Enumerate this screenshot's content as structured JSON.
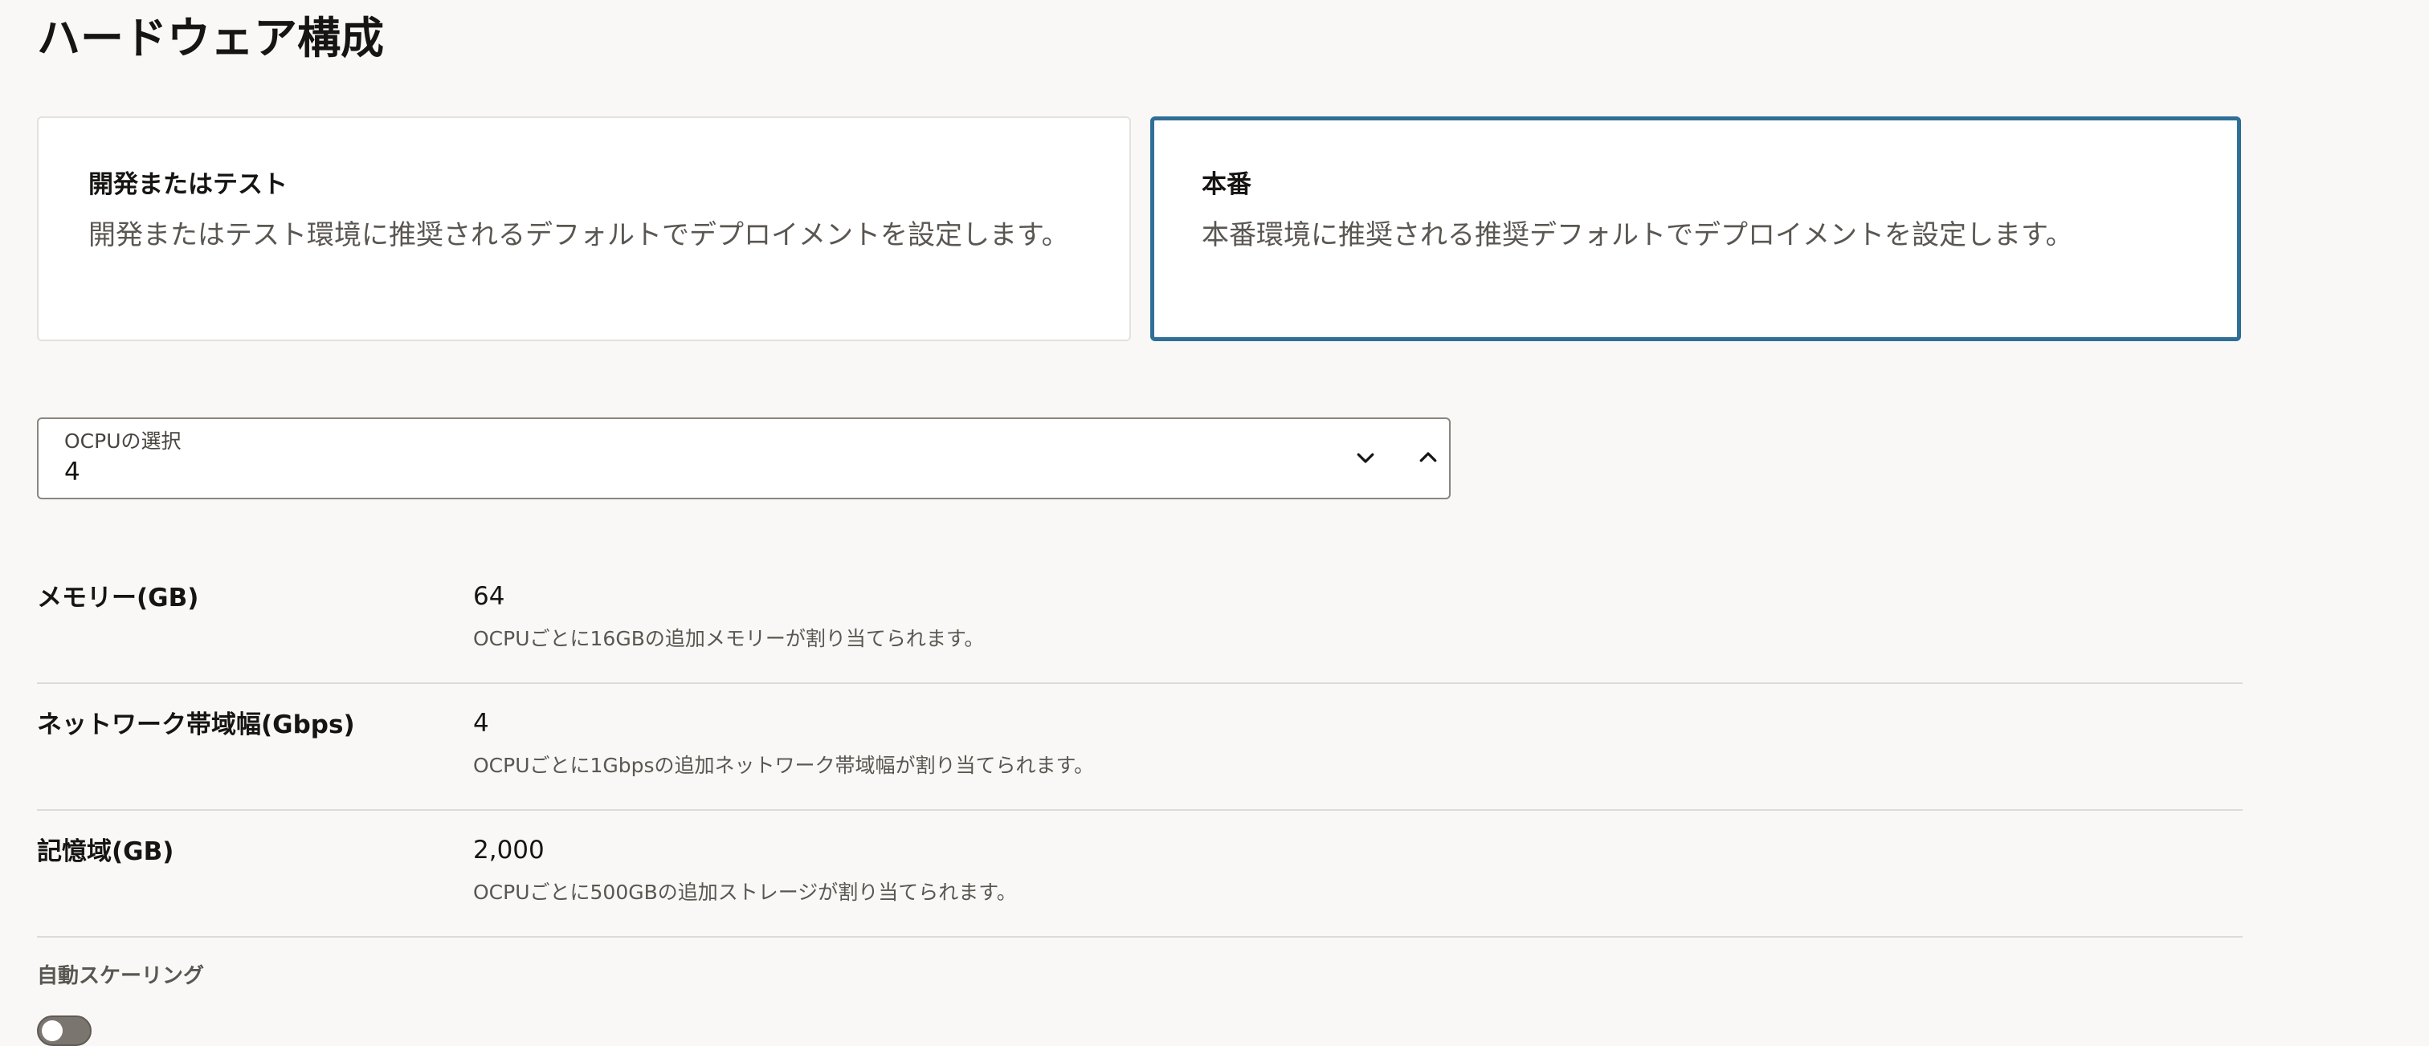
{
  "page": {
    "title": "ハードウェア構成"
  },
  "presets": [
    {
      "title": "開発またはテスト",
      "description": "開発またはテスト環境に推奨されるデフォルトでデプロイメントを設定します。",
      "selected": false
    },
    {
      "title": "本番",
      "description": "本番環境に推奨される推奨デフォルトでデプロイメントを設定します。",
      "selected": true
    }
  ],
  "ocpu": {
    "label": "OCPUの選択",
    "value": "4",
    "decrement_icon": "chevron-down-icon",
    "increment_icon": "chevron-up-icon"
  },
  "specs": [
    {
      "label": "メモリー(GB)",
      "value": "64",
      "help": "OCPUごとに16GBの追加メモリーが割り当てられます。"
    },
    {
      "label": "ネットワーク帯域幅(Gbps)",
      "value": "4",
      "help": "OCPUごとに1Gbpsの追加ネットワーク帯域幅が割り当てられます。"
    },
    {
      "label": "記憶域(GB)",
      "value": "2,000",
      "help": "OCPUごとに500GBの追加ストレージが割り当てられます。"
    }
  ],
  "autoscaling": {
    "label": "自動スケーリング",
    "enabled": false
  },
  "colors": {
    "accent": "#2f6f97",
    "background": "#f9f8f6",
    "toggle_off": "#7b756f"
  }
}
